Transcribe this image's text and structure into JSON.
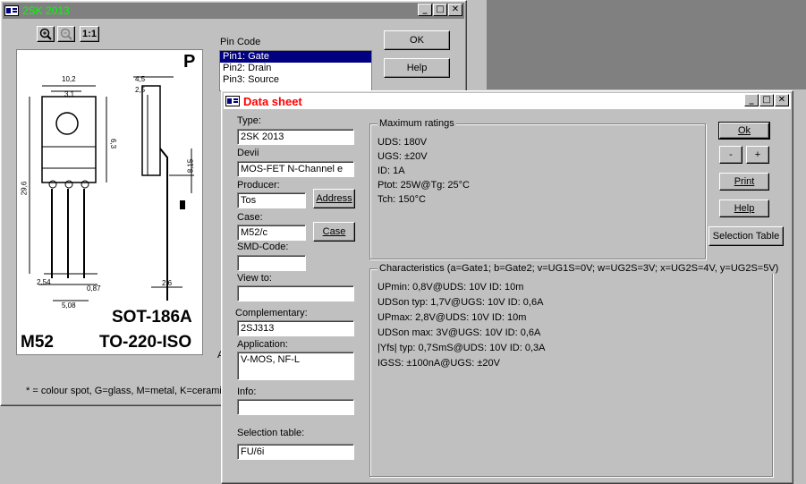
{
  "main_window": {
    "title": "2SK 2013",
    "zoom_label": "1:1",
    "pin_code_label": "Pin Code",
    "pins": [
      "Pin1: Gate",
      "Pin2: Drain",
      "Pin3: Source"
    ],
    "ok_label": "OK",
    "help_label": "Help",
    "footnote": "* = colour spot, G=glass, M=metal, K=ceramic,",
    "stray_letter": "A"
  },
  "package_drawing": {
    "corner_letter": "P",
    "package_code": "M52",
    "package_name_1": "SOT-186A",
    "package_name_2": "TO-220-ISO",
    "dims": [
      "10,2",
      "3,1",
      "4,5",
      "2,5",
      "6,3",
      "8,15",
      "29,6",
      "2,54",
      "0,87",
      "5,08",
      "2,6"
    ]
  },
  "datasheet": {
    "title": "Data sheet",
    "type_label": "Type:",
    "type_value": "2SK 2013",
    "devii_label": "Devii",
    "devii_value": "MOS-FET N-Channel e",
    "producer_label": "Producer:",
    "producer_value": "Tos",
    "address_button": "Address",
    "case_label": "Case:",
    "case_value": "M52/c",
    "case_button": "Case",
    "smd_label": "SMD-Code:",
    "smd_value": "",
    "viewto_label": "View to:",
    "viewto_value": "",
    "complementary_label": "Complementary:",
    "complementary_value": "2SJ313",
    "application_label": "Application:",
    "application_value": "V-MOS, NF-L",
    "info_label": "Info:",
    "info_value": "",
    "selection_label": "Selection table:",
    "selection_value": "FU/6i",
    "max_ratings_title": "Maximum ratings",
    "max_ratings": [
      "UDS: 180V",
      "UGS: ±20V",
      "ID: 1A",
      "Ptot: 25W@Tg: 25°C",
      "Tch: 150°C"
    ],
    "characteristics_title": "Characteristics (a=Gate1; b=Gate2; v=UG1S=0V; w=UG2S=3V; x=UG2S=4V, y=UG2S=5V)",
    "characteristics": [
      "UPmin: 0,8V@UDS: 10V ID: 10m",
      "UDSon typ: 1,7V@UGS: 10V ID: 0,6A",
      "UPmax: 2,8V@UDS: 10V ID: 10m",
      "UDSon max: 3V@UGS: 10V ID: 0,6A",
      "|Yfs| typ: 0,7SmS@UDS: 10V ID: 0,3A",
      "IGSS: ±100nA@UGS: ±20V"
    ],
    "ok_button": "Ok",
    "minus_button": "-",
    "plus_button": "+",
    "print_button": "Print",
    "help_button": "Help",
    "selection_table_button": "Selection Table"
  },
  "colors": {
    "main_title_text": "#00ff00",
    "datasheet_title_text": "#ff0000",
    "selected_row": "#000080"
  }
}
